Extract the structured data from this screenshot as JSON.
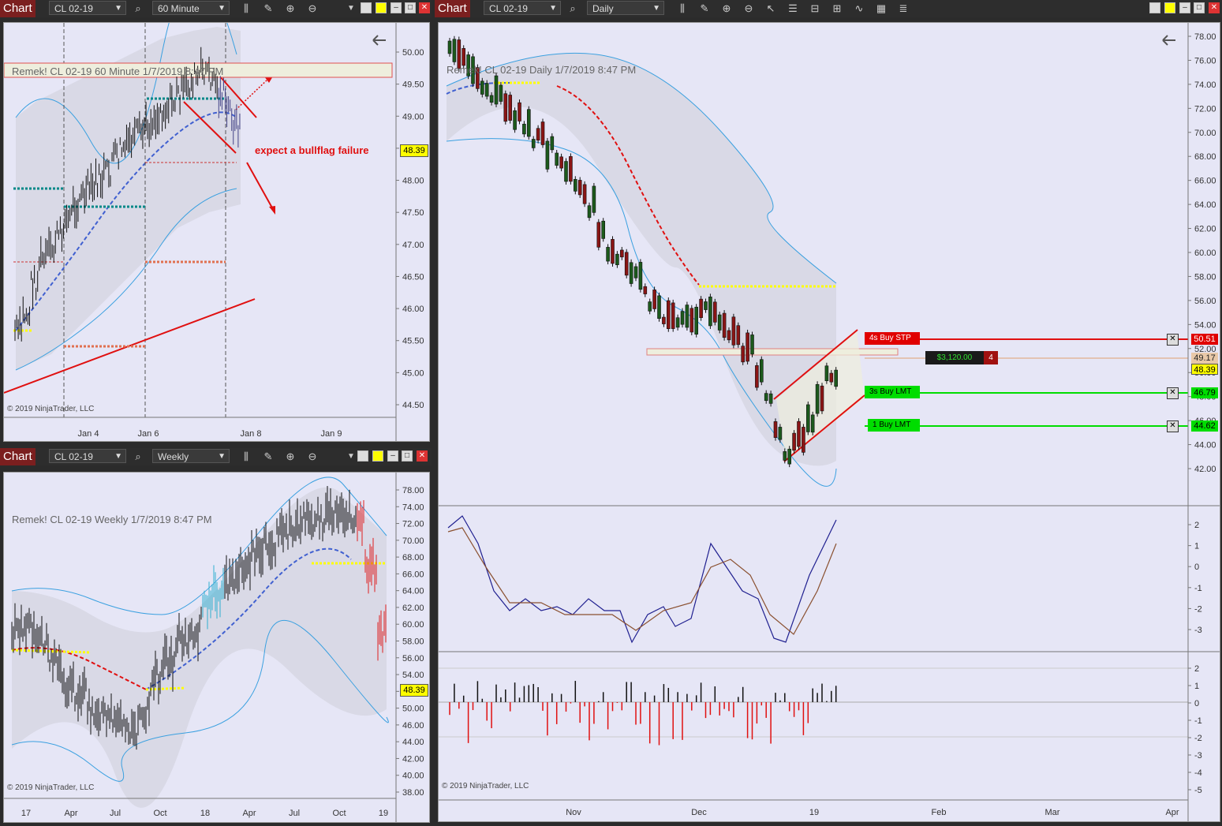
{
  "windows": {
    "hourly": {
      "title": "Chart",
      "instrument": "CL 02-19",
      "period": "60 Minute",
      "caption": "Remek!  CL 02-19  60 Minute  1/7/2019 8:47 PM",
      "annotation": "expect a bullflag failure",
      "price_badge": "48.39",
      "copyright": "© 2019 NinjaTrader, LLC",
      "y_ticks": [
        "50.00",
        "49.50",
        "49.00",
        "48.50",
        "48.00",
        "47.50",
        "47.00",
        "46.50",
        "46.00",
        "45.50",
        "45.00",
        "44.50"
      ],
      "x_ticks": [
        "Jan 4",
        "Jan 6",
        "Jan 8",
        "Jan 9"
      ]
    },
    "weekly": {
      "title": "Chart",
      "instrument": "CL 02-19",
      "period": "Weekly",
      "caption": "Remek!  CL 02-19  Weekly  1/7/2019 8:47 PM",
      "price_badge": "48.39",
      "copyright": "© 2019 NinjaTrader, LLC",
      "y_ticks": [
        "78.00",
        "74.00",
        "72.00",
        "70.00",
        "68.00",
        "66.00",
        "64.00",
        "62.00",
        "60.00",
        "58.00",
        "56.00",
        "54.00",
        "52.00",
        "50.00",
        "46.00",
        "44.00",
        "42.00",
        "40.00",
        "38.00"
      ],
      "x_ticks": [
        "17",
        "Apr",
        "Jul",
        "Oct",
        "18",
        "Apr",
        "Jul",
        "Oct",
        "19"
      ]
    },
    "daily": {
      "title": "Chart",
      "instrument": "CL 02-19",
      "period": "Daily",
      "caption": "Remek!  CL 02-19  Daily  1/7/2019 8:47 PM",
      "copyright": "© 2019 NinjaTrader, LLC",
      "y_ticks": [
        "78.00",
        "76.00",
        "74.00",
        "72.00",
        "70.00",
        "68.00",
        "66.00",
        "64.00",
        "62.00",
        "60.00",
        "58.00",
        "56.00",
        "54.00",
        "52.00",
        "50.00",
        "48.00",
        "46.00",
        "44.00",
        "42.00"
      ],
      "osc_ticks": [
        "2",
        "1",
        "0",
        "-1",
        "-2",
        "-3"
      ],
      "hist_ticks": [
        "2",
        "1",
        "0",
        "-1",
        "-2",
        "-3",
        "-4",
        "-5"
      ],
      "x_ticks": [
        "Nov",
        "Dec",
        "19",
        "Feb",
        "Mar",
        "Apr"
      ],
      "orders": [
        {
          "label": "4s  Buy STP",
          "price": "50.51",
          "color": "#e00000"
        },
        {
          "label": "3s  Buy LMT",
          "price": "46.79",
          "color": "#00dd00"
        },
        {
          "label": "1  Buy LMT",
          "price": "44.62",
          "color": "#00dd00"
        }
      ],
      "position": {
        "pnl": "$3,120.00",
        "qty": "4",
        "avg_price": "49.17"
      },
      "last_price": "48.39"
    }
  }
}
